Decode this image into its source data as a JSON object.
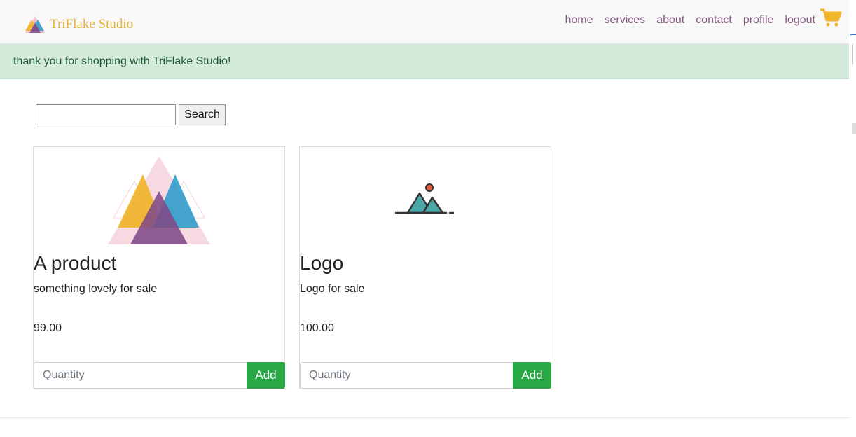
{
  "brand": {
    "name": "TriFlake Studio"
  },
  "nav": {
    "items": [
      "home",
      "services",
      "about",
      "contact",
      "profile",
      "logout"
    ],
    "cart_icon": "shopping-cart-icon"
  },
  "alert": {
    "message": "thank you for shopping with TriFlake Studio!"
  },
  "search": {
    "value": "",
    "button_label": "Search"
  },
  "products": [
    {
      "title": "A product",
      "description": "something lovely for sale",
      "price": "99.00",
      "quantity_placeholder": "Quantity",
      "add_label": "Add",
      "image_icon": "triflake-triangles-image"
    },
    {
      "title": "Logo",
      "description": "Logo for sale",
      "price": "100.00",
      "quantity_placeholder": "Quantity",
      "add_label": "Add",
      "image_icon": "mountain-landscape-image"
    }
  ],
  "colors": {
    "brand": "#e4b33b",
    "nav_link": "#84597f",
    "alert_bg": "#d4ebdb",
    "alert_text": "#1e5a30",
    "add_button": "#28a745",
    "cart": "#f0b429"
  }
}
